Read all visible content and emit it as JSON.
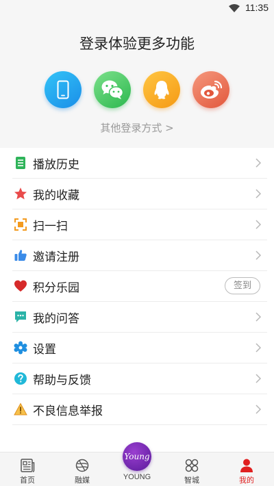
{
  "status_bar": {
    "time": "11:35"
  },
  "login": {
    "title": "登录体验更多功能",
    "methods": [
      {
        "icon": "phone-icon",
        "color": "#1a8ee8"
      },
      {
        "icon": "wechat-icon",
        "color": "#2db84f"
      },
      {
        "icon": "qq-icon",
        "color": "#f59a14"
      },
      {
        "icon": "weibo-icon",
        "color": "#e2573c"
      }
    ],
    "other_login": "其他登录方式 >"
  },
  "menu": [
    {
      "label": "播放历史",
      "icon": "history-icon",
      "color": "#2fb45a"
    },
    {
      "label": "我的收藏",
      "icon": "star-icon",
      "color": "#e94b4b"
    },
    {
      "label": "扫一扫",
      "icon": "scan-icon",
      "color": "#f39a1e"
    },
    {
      "label": "邀请注册",
      "icon": "thumbs-up-icon",
      "color": "#3a8be8"
    },
    {
      "label": "积分乐园",
      "icon": "heart-icon",
      "color": "#d62a2a",
      "action": "签到"
    },
    {
      "label": "我的问答",
      "icon": "chat-icon",
      "color": "#2bb3a8"
    },
    {
      "label": "设置",
      "icon": "gear-icon",
      "color": "#1f8fe0"
    },
    {
      "label": "帮助与反馈",
      "icon": "help-icon",
      "color": "#20b8d8"
    },
    {
      "label": "不良信息举报",
      "icon": "warning-icon",
      "color": "#f0a020"
    }
  ],
  "tabbar": {
    "tabs": [
      {
        "label": "首页",
        "icon": "newspaper-icon"
      },
      {
        "label": "融媒",
        "icon": "media-icon"
      },
      {
        "label": "YOUNG",
        "icon": "young-logo"
      },
      {
        "label": "智城",
        "icon": "grid-icon"
      },
      {
        "label": "我的",
        "icon": "person-icon"
      }
    ],
    "active_color": "#e02020",
    "young_logo_text": "Young"
  }
}
